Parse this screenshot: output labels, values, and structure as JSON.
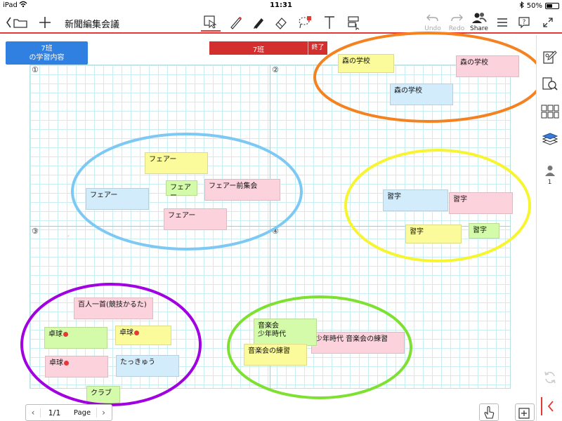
{
  "status_bar": {
    "carrier": "iPad",
    "time": "11:31",
    "battery": "50%",
    "battery_level": 0.5
  },
  "toolbar": {
    "back_icon": "back-to-folder-icon",
    "add_icon": "plus-icon",
    "document_title": "新聞編集会議",
    "tools": [
      "select-icon",
      "pen-icon",
      "marker-icon",
      "eraser-icon",
      "lasso-icon",
      "text-icon",
      "shape-icon"
    ],
    "undo_label": "Undo",
    "redo_label": "Redo",
    "share_label": "Share"
  },
  "session": {
    "class_button": [
      "7班",
      "の学習内容"
    ],
    "title": "7班",
    "end_label": "終了"
  },
  "quadrants": [
    "①",
    "②",
    "③",
    "④"
  ],
  "notes": {
    "q2": [
      "森の学校",
      "森の学校",
      "森の学校"
    ],
    "q1": [
      "フェアー",
      "フェアー",
      "フェアー",
      "フェアー前集会",
      "フェアー"
    ],
    "q2b": [
      "習字",
      "習字",
      "習字",
      "習字"
    ],
    "q3": [
      "百人一首(競技かるた)",
      "卓球",
      "卓球",
      "卓球",
      "たっきゅう",
      "クラブ"
    ],
    "q4": [
      "音楽会",
      "少年時代",
      "少年時代 音楽会の練習",
      "音楽会の練習"
    ]
  },
  "ellipse_colors": {
    "orange": "#f58220",
    "blue": "#7ec8f4",
    "yellow": "#f7f530",
    "purple": "#a100e0",
    "green": "#7ee030"
  },
  "right_panel": {
    "user_count": "1"
  },
  "pager": {
    "page": "1/1",
    "label": "Page"
  }
}
